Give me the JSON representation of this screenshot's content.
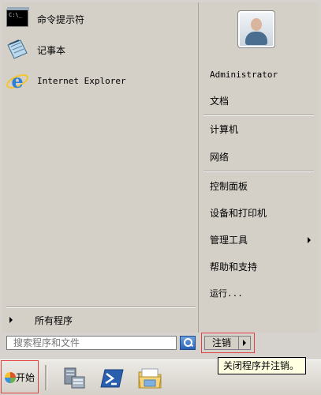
{
  "programs": [
    {
      "label": "命令提示符",
      "icon": "command-prompt-icon"
    },
    {
      "label": "记事本",
      "icon": "notepad-icon"
    },
    {
      "label": "Internet Explorer",
      "icon": "internet-explorer-icon"
    }
  ],
  "all_programs_label": "所有程序",
  "search": {
    "placeholder": "搜索程序和文件"
  },
  "user": {
    "name": "Administrator"
  },
  "right_items": {
    "documents": "文档",
    "computer": "计算机",
    "network": "网络",
    "control_panel": "控制面板",
    "devices_printers": "设备和打印机",
    "admin_tools": "管理工具",
    "help_support": "帮助和支持",
    "run": "运行..."
  },
  "logoff": {
    "label": "注销",
    "tooltip": "关闭程序并注销。"
  },
  "taskbar": {
    "start_label": "开始",
    "pinned": [
      "server-manager-icon",
      "powershell-icon",
      "explorer-folder-icon"
    ]
  },
  "colors": {
    "accent": "#e34040",
    "menu_bg": "#d4d0c8",
    "tooltip_bg": "#ffffe1"
  }
}
